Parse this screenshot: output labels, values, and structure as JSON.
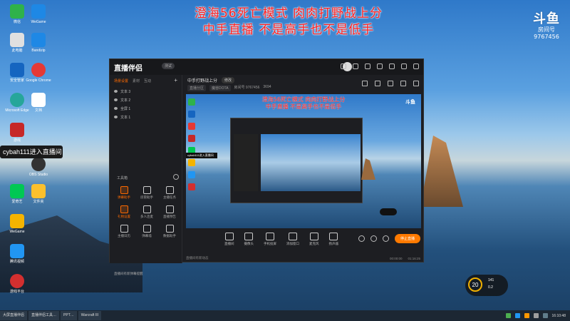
{
  "overlay": {
    "line1": "澄海56死亡模式 肉肉打野战上分",
    "line2": "中手直播 不是高手也不是低手"
  },
  "brand": {
    "logo": "斗鱼",
    "room_label": "房间号",
    "room_id": "9767456"
  },
  "tooltip": "cybah111进入直播间",
  "desktop_icons": [
    {
      "label": "微信",
      "color": "#2fb24a"
    },
    {
      "label": "WeGame",
      "color": "#1e88e5"
    },
    {
      "label": "此电脑",
      "color": "#e0e0e0"
    },
    {
      "label": "Bandizip",
      "color": "#1e88e5"
    },
    {
      "label": "安全管家",
      "color": "#1565c0"
    },
    {
      "label": "Google Chrome",
      "color": "#e53935"
    },
    {
      "label": "Microsoft Edge",
      "color": "#26a69a"
    },
    {
      "label": "文档",
      "color": "#ffffff"
    },
    {
      "label": "游戏",
      "color": "#c62828"
    },
    {
      "label": "OBS Studio",
      "color": "#333333"
    },
    {
      "label": "爱奇艺",
      "color": "#00c853"
    },
    {
      "label": "文件夹",
      "color": "#fbc02d"
    },
    {
      "label": "WeGame",
      "color": "#f5b400"
    },
    {
      "label": "腾讯视频",
      "color": "#2196f3"
    },
    {
      "label": "游戏平台",
      "color": "#d32f2f"
    }
  ],
  "app": {
    "logo": "直播伴侣",
    "badge": "测试",
    "left_tabs": [
      "场景设置",
      "素材",
      "互动"
    ],
    "scenes": [
      "文本 3",
      "文本 2",
      "全屏 1",
      "文本 1"
    ],
    "tools_title": "工具箱",
    "tools": [
      "弹幕助手",
      "房管助手",
      "主播任务",
      "礼物设置",
      "多人连麦",
      "直播预告",
      "主播日历",
      "弹幕墙",
      "数据助手"
    ],
    "stream_title": "中手打野战上分",
    "stream_chip": "修改",
    "sub_chips": [
      "直播分区",
      "魔兽DOTA"
    ],
    "sub_info": [
      "房间号 9767456",
      "3694"
    ],
    "controls": [
      "直播间",
      "摄像头",
      "手机投屏",
      "添加窗口",
      "麦克风",
      "扬声器"
    ],
    "stop_button": "停止直播",
    "status_left": "直播间有新动态",
    "status_time1": "00:00:00",
    "status_time2": "01:16:25",
    "footer": "直播间有新弹幕提醒"
  },
  "perf": {
    "value": "20",
    "a": "141",
    "b": "0.2"
  },
  "taskbar": {
    "items": [
      "大屏直播伴侣",
      "直播伴侣工具…",
      "PPT…",
      "Warcraft III"
    ],
    "clock": "16:10:48"
  }
}
